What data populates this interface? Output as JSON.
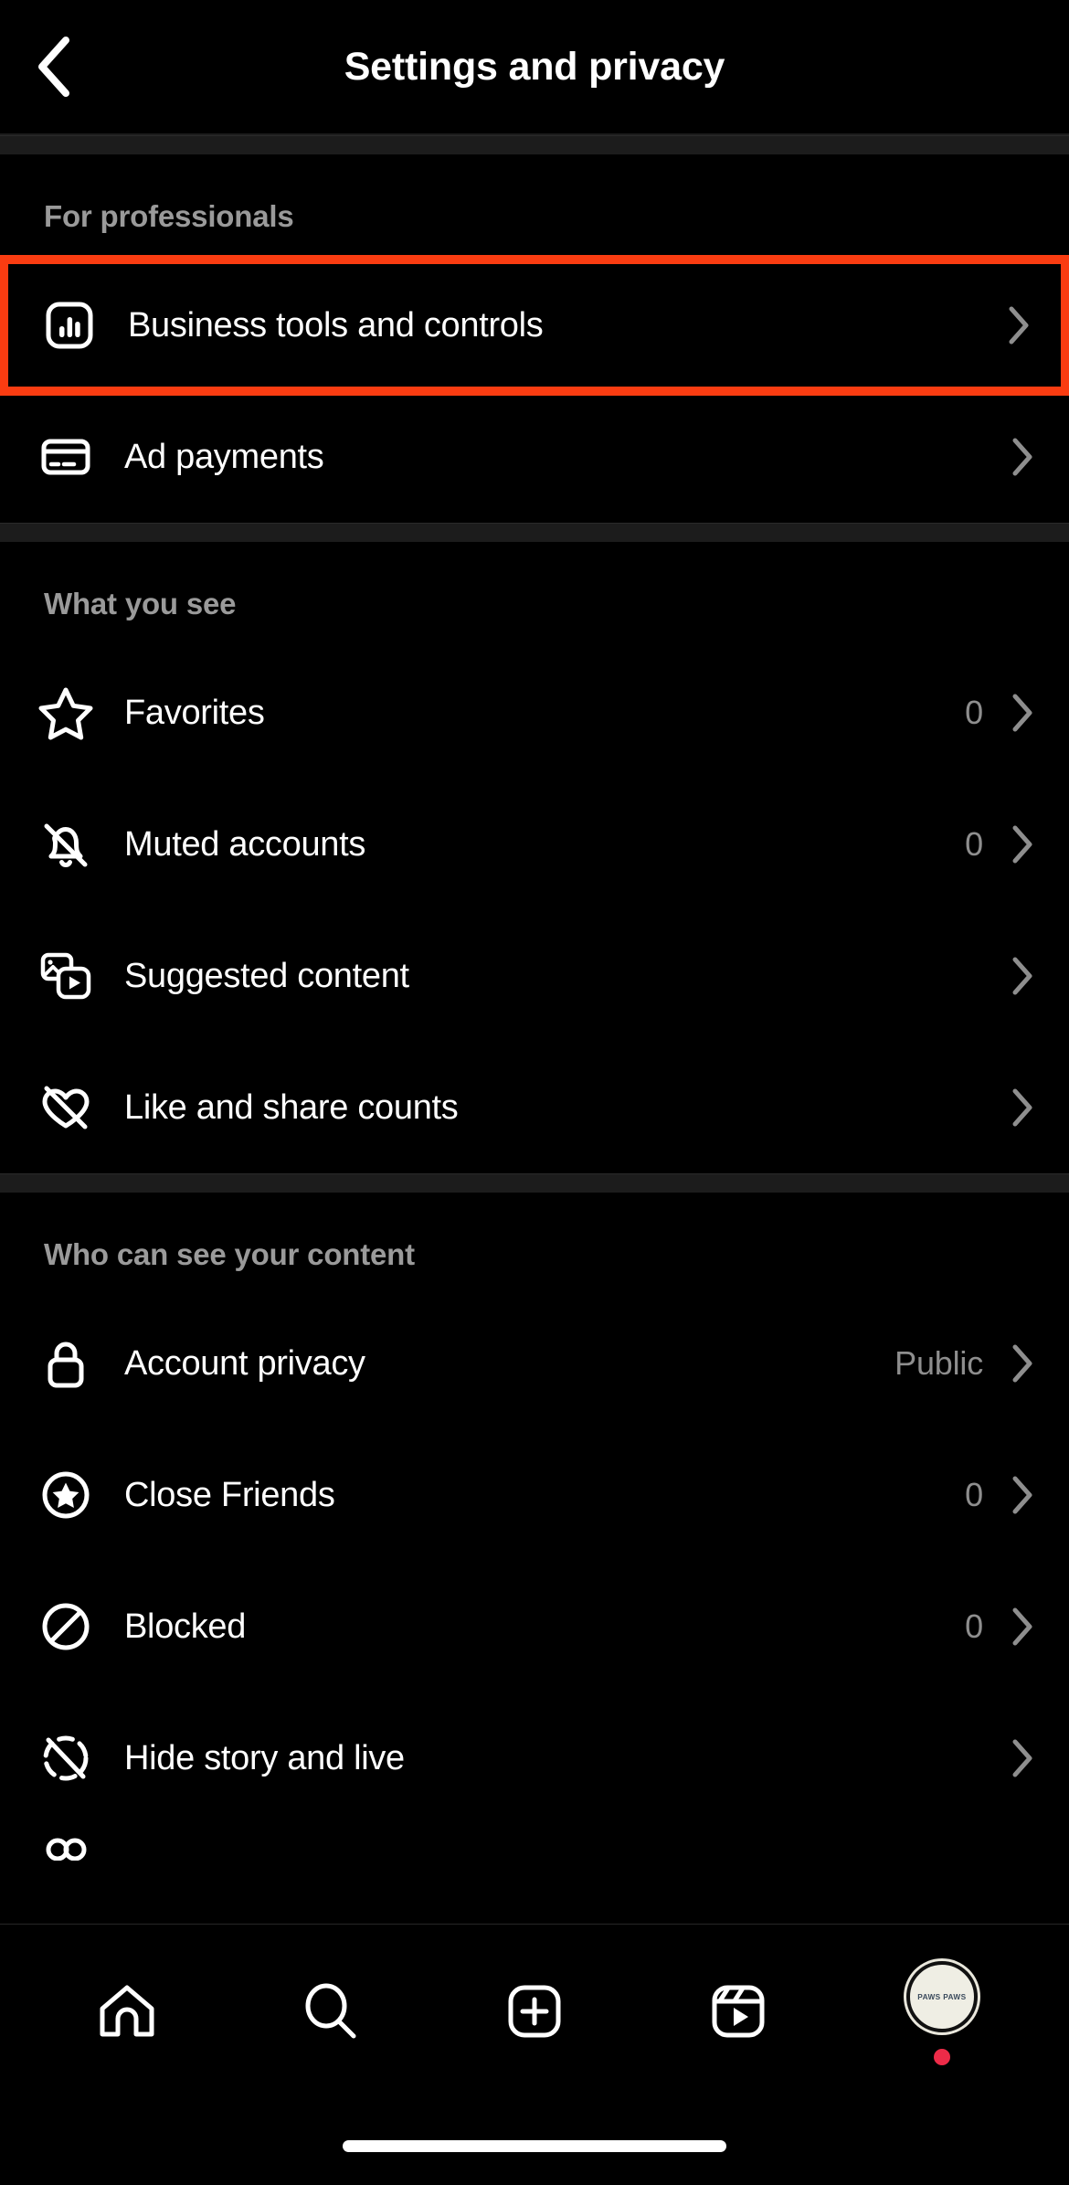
{
  "header": {
    "title": "Settings and privacy",
    "back_icon": "chevron-left-icon"
  },
  "sections": [
    {
      "id": "for-professionals",
      "title": "For professionals",
      "rows": [
        {
          "id": "business-tools-and-controls",
          "label": "Business tools and controls",
          "icon": "bar-chart-square-icon",
          "value": "",
          "highlighted": true
        },
        {
          "id": "ad-payments",
          "label": "Ad payments",
          "icon": "credit-card-icon",
          "value": "",
          "highlighted": false
        }
      ]
    },
    {
      "id": "what-you-see",
      "title": "What you see",
      "rows": [
        {
          "id": "favorites",
          "label": "Favorites",
          "icon": "star-outline-icon",
          "value": "0",
          "highlighted": false
        },
        {
          "id": "muted-accounts",
          "label": "Muted accounts",
          "icon": "bell-slash-icon",
          "value": "0",
          "highlighted": false
        },
        {
          "id": "suggested-content",
          "label": "Suggested content",
          "icon": "photo-video-icon",
          "value": "",
          "highlighted": false
        },
        {
          "id": "like-and-share-counts",
          "label": "Like and share counts",
          "icon": "heart-slash-icon",
          "value": "",
          "highlighted": false
        }
      ]
    },
    {
      "id": "who-can-see-your-content",
      "title": "Who can see your content",
      "rows": [
        {
          "id": "account-privacy",
          "label": "Account privacy",
          "icon": "lock-icon",
          "value": "Public",
          "highlighted": false
        },
        {
          "id": "close-friends",
          "label": "Close Friends",
          "icon": "star-circle-icon",
          "value": "0",
          "highlighted": false
        },
        {
          "id": "blocked",
          "label": "Blocked",
          "icon": "block-circle-icon",
          "value": "0",
          "highlighted": false
        },
        {
          "id": "hide-story-and-live",
          "label": "Hide story and live",
          "icon": "dashed-circle-slash-icon",
          "value": "",
          "highlighted": false
        }
      ]
    }
  ],
  "bottom_nav": {
    "items": [
      {
        "id": "home",
        "icon": "home-icon"
      },
      {
        "id": "search",
        "icon": "search-icon"
      },
      {
        "id": "create",
        "icon": "plus-square-icon"
      },
      {
        "id": "reels",
        "icon": "reels-icon"
      },
      {
        "id": "profile",
        "icon": "avatar"
      }
    ],
    "avatar_text": "PAWS PAWS"
  },
  "colors": {
    "background": "#000000",
    "highlight": "#fa3c11",
    "section_title": "#9a9a9a",
    "value_text": "#8e8e8e",
    "separator": "#1c1c1c",
    "notification_dot": "#ed2b48",
    "avatar_bg": "#efeee4"
  }
}
